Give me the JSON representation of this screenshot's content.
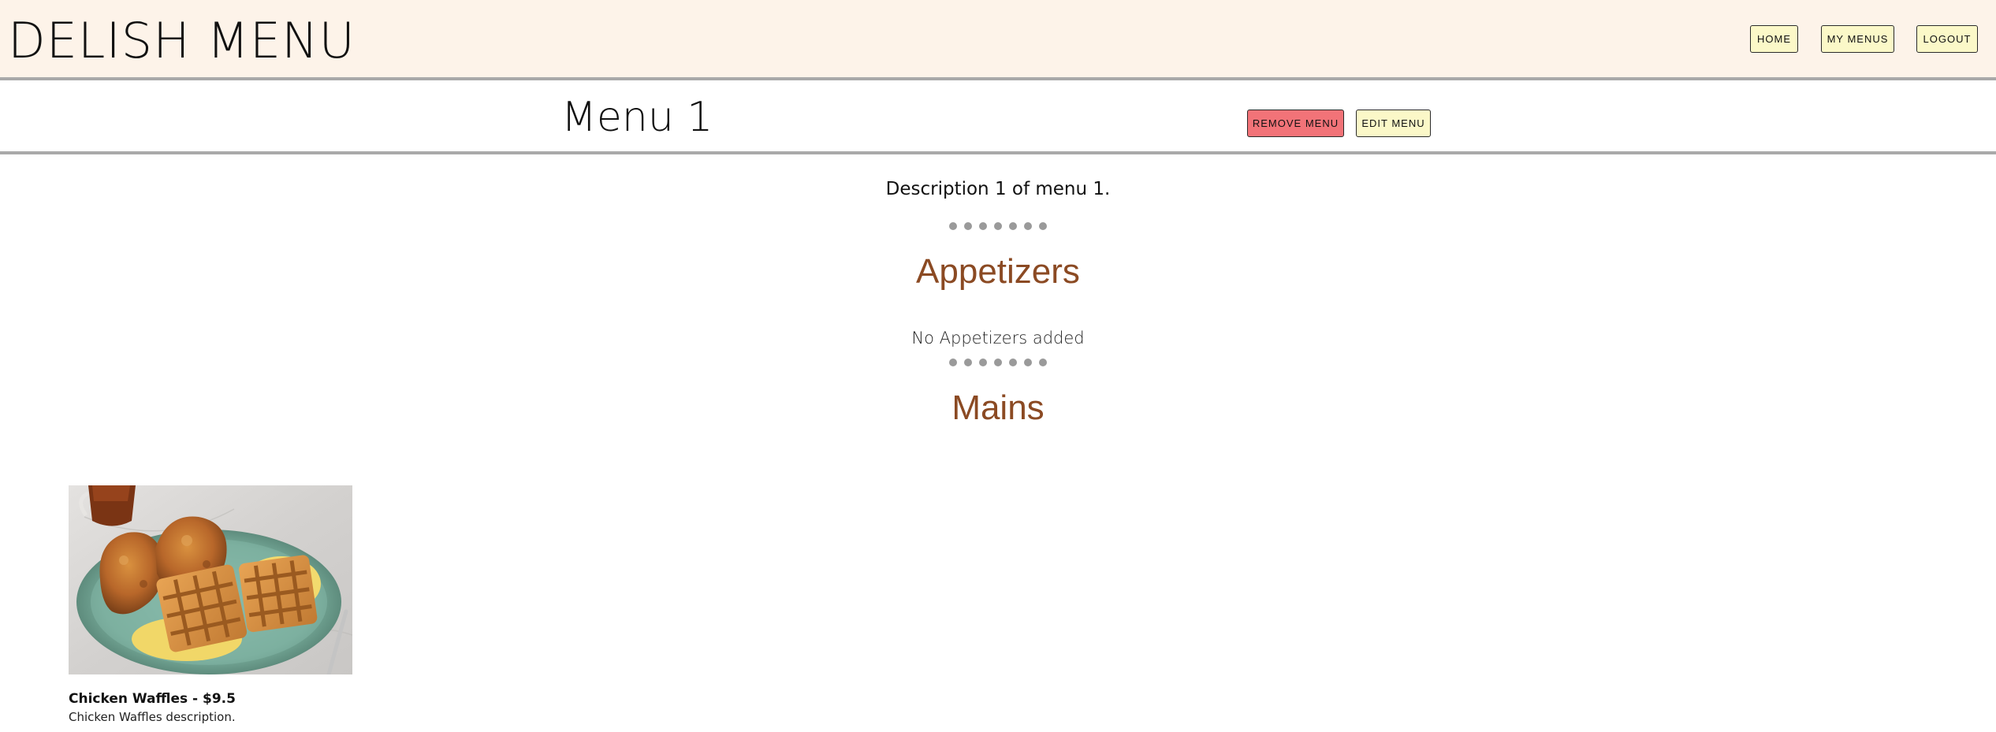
{
  "header": {
    "brand": "DELISH MENU",
    "nav": {
      "home_label": "HOME",
      "my_menus_label": "MY MENUS",
      "logout_label": "LOGOUT"
    }
  },
  "menu": {
    "title": "Menu 1",
    "remove_label": "REMOVE MENU",
    "edit_label": "EDIT MENU",
    "description": "Description 1 of menu 1."
  },
  "sections": {
    "appetizers": {
      "title": "Appetizers",
      "empty_note": "No Appetizers added"
    },
    "mains": {
      "title": "Mains",
      "items": [
        {
          "name_price": "Chicken Waffles - $9.5",
          "description": "Chicken Waffles description."
        }
      ]
    }
  },
  "colors": {
    "header_bg": "#fdf3e9",
    "button_bg": "#fbf8c8",
    "remove_button_bg": "#f27378",
    "section_title": "#8b4a23",
    "divider": "#a9a9a9"
  }
}
